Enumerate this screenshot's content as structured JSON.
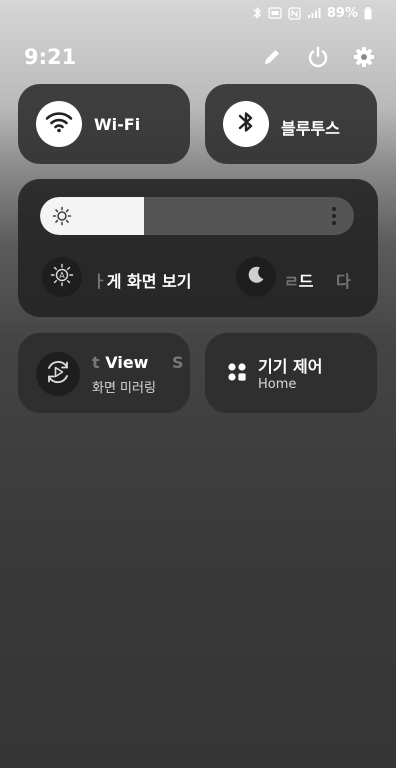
{
  "status_bar": {
    "battery_percent": "89%",
    "icons": [
      "bluetooth-icon",
      "sim-card-icon",
      "nfc-icon",
      "signal-icon",
      "battery-icon"
    ]
  },
  "header": {
    "time": "9:21",
    "actions": [
      "edit-pencil-icon",
      "power-icon",
      "settings-gear-icon"
    ]
  },
  "quick_tiles": [
    {
      "id": "wifi",
      "label": "Wi-Fi",
      "icon": "wifi-icon",
      "active": true
    },
    {
      "id": "bluetooth",
      "label": "블루투스",
      "icon": "bluetooth-icon",
      "active": true
    }
  ],
  "brightness": {
    "level": 0.33,
    "sun_icon": "brightness-sun-icon",
    "more_icon": "vertical-dots-icon"
  },
  "panel_row": {
    "eye_comfort_label": "게 화면 보기",
    "eye_comfort_prefix": "ㅏ",
    "night_label": "드",
    "night_extra": "다",
    "night_prefix": "ㄹ"
  },
  "smart_view": {
    "title_main": "View",
    "title_prefix": "t",
    "title_suffix": "S",
    "subtitle": "화면 미러링",
    "icon": "smart-view-play-icon"
  },
  "device_control": {
    "title": "기기 제어",
    "subtitle": "Home",
    "icon": "grid-apps-icon"
  },
  "colors": {
    "tile_bg": "#2c2c2c",
    "active_circle": "#ffffff",
    "slider_fill": "#f4f4f4",
    "slider_track": "#555555"
  }
}
